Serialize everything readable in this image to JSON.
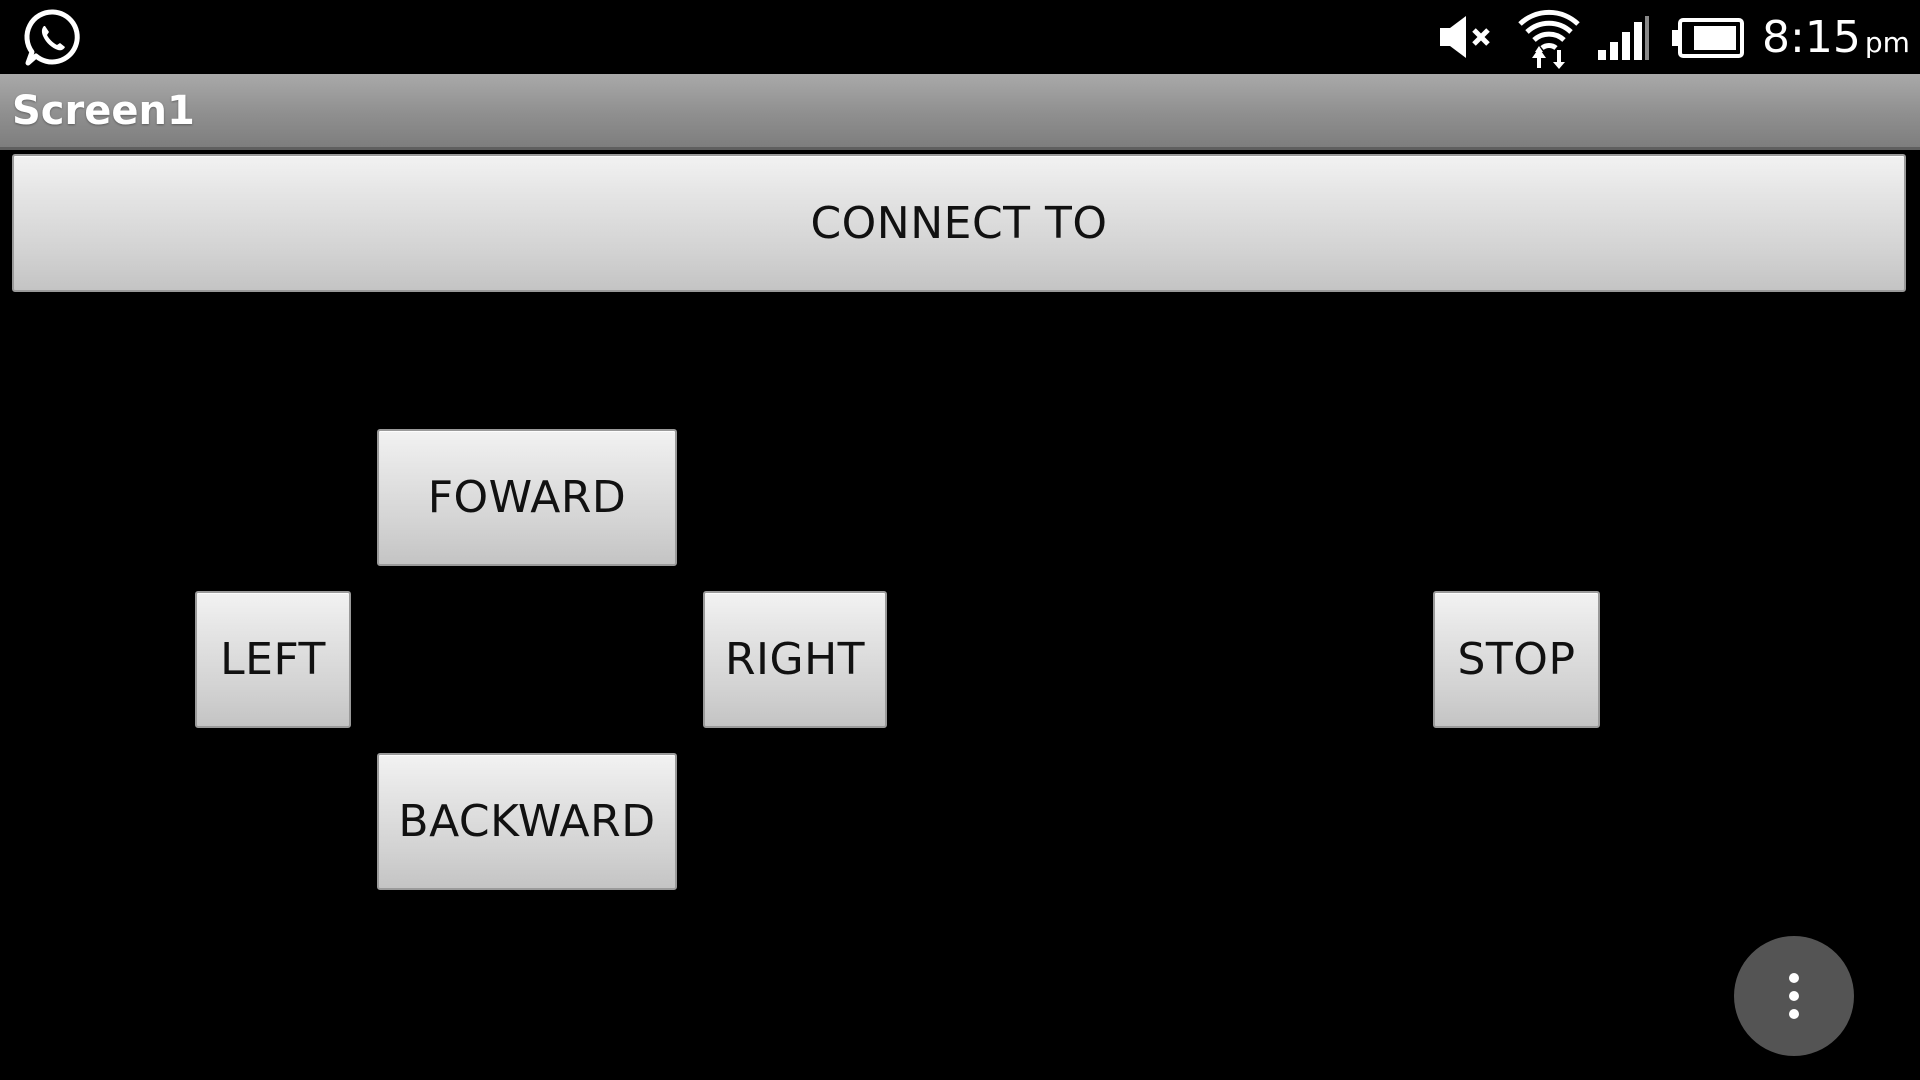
{
  "status_bar": {
    "time": "8:15",
    "ampm": "pm",
    "icons": [
      "whatsapp-icon",
      "mute-icon",
      "wifi-icon",
      "signal-icon",
      "battery-icon"
    ]
  },
  "title_bar": {
    "title": "Screen1"
  },
  "buttons": {
    "connect": "CONNECT TO",
    "forward": "FOWARD",
    "left": "LEFT",
    "right": "RIGHT",
    "backward": "BACKWARD",
    "stop": "STOP"
  },
  "overflow_menu": {
    "icon": "more-vert-icon"
  },
  "colors": {
    "background": "#000000",
    "title_bar": "#8f8f8f",
    "button_face": "#dcdcdc",
    "fab": "#545454"
  }
}
